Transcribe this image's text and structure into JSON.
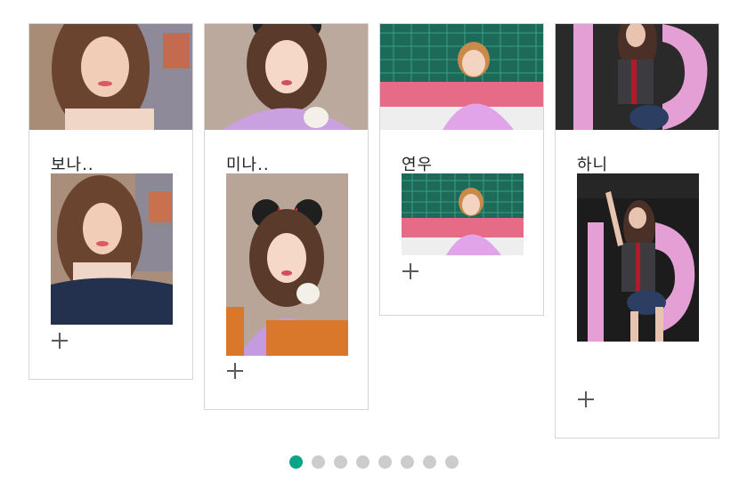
{
  "cards": [
    {
      "name": "보나..",
      "cover_photo": "portrait-photo-woman-long-hair",
      "inner_photo": "portrait-photo-woman-long-hair"
    },
    {
      "name": "미나..",
      "cover_photo": "portrait-photo-woman-minnie-ears",
      "inner_photo": "portrait-photo-woman-minnie-ears"
    },
    {
      "name": "연우",
      "cover_photo": "stage-photo-woman-pink-top",
      "inner_photo": "stage-photo-woman-pink-top"
    },
    {
      "name": "하니",
      "cover_photo": "stage-photo-dancer-pink-backdrop",
      "inner_photo": "stage-photo-dancer-pink-backdrop"
    }
  ],
  "add_icon": "plus-icon",
  "pagination": {
    "total": 8,
    "active": 1
  },
  "colors": {
    "accent": "#0aa385",
    "inactive_dot": "#cccccc",
    "card_border": "#d6d6d6"
  }
}
